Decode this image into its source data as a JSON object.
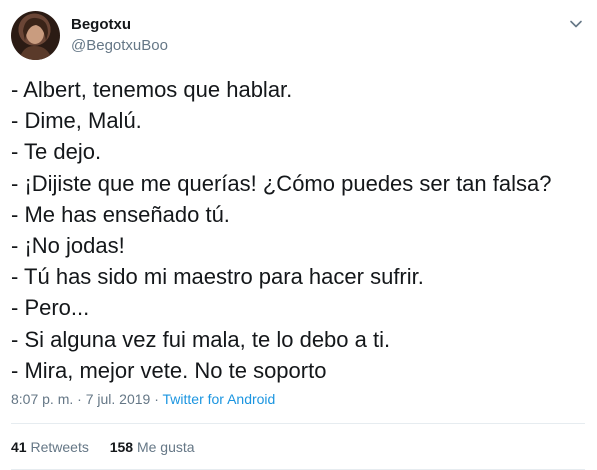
{
  "user": {
    "display_name": "Begotxu",
    "handle": "@BegotxuBoo"
  },
  "tweet": {
    "lines": [
      "- Albert, tenemos que hablar.",
      "- Dime, Malú.",
      "- Te dejo.",
      "- ¡Dijiste que me querías! ¿Cómo puedes ser tan falsa?",
      "- Me has enseñado tú.",
      "- ¡No jodas!",
      "- Tú has sido mi maestro para hacer sufrir.",
      "- Pero...",
      "- Si alguna vez fui mala, te lo debo a ti.",
      "- Mira, mejor vete. No te soporto"
    ],
    "timestamp": "8:07 p. m. · 7 jul. 2019 · ",
    "source": "Twitter for Android"
  },
  "stats": {
    "retweets_count": "41",
    "retweets_label": "Retweets",
    "likes_count": "158",
    "likes_label": "Me gusta"
  },
  "icons": {
    "menu": "chevron-down-icon"
  },
  "colors": {
    "link": "#1b95e0",
    "secondary_text": "#657786",
    "primary_text": "#14171a"
  }
}
